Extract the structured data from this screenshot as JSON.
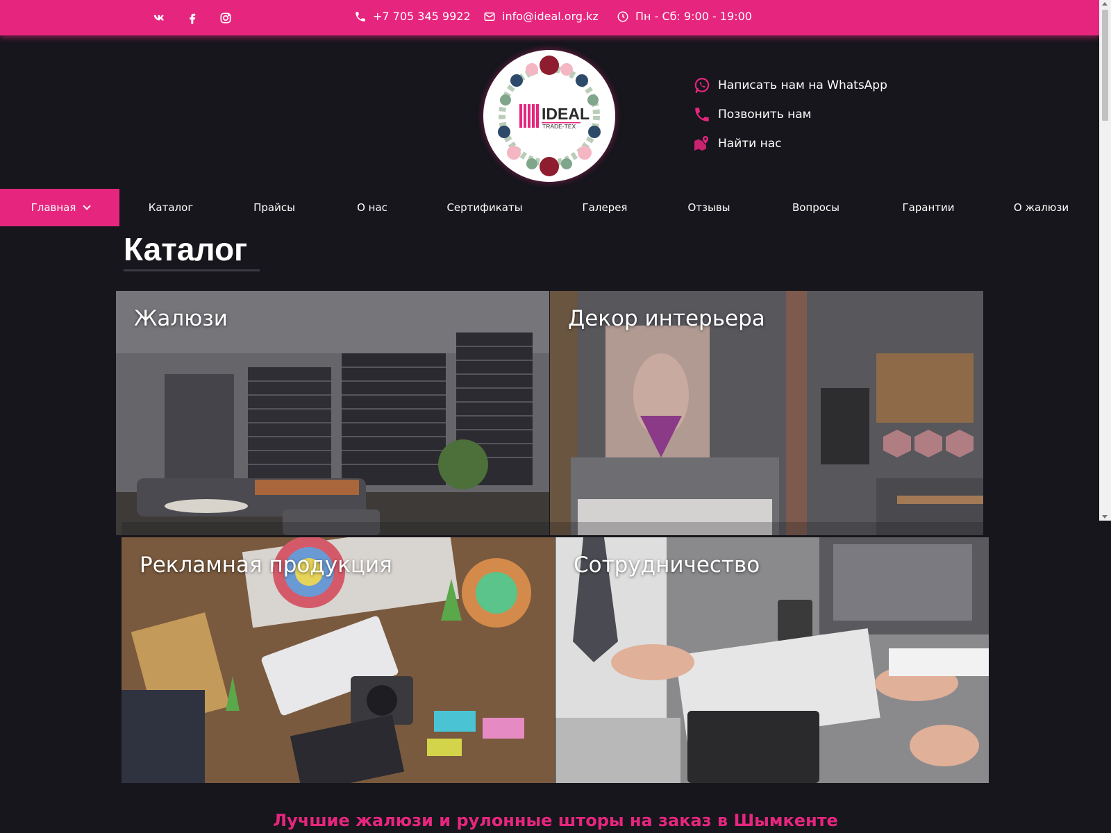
{
  "topbar": {
    "social": [
      {
        "name": "vk-icon"
      },
      {
        "name": "facebook-icon"
      },
      {
        "name": "instagram-icon"
      }
    ],
    "phone": "+7 705 345 9922",
    "email": "info@ideal.org.kz",
    "hours": "Пн - Сб: 9:00 - 19:00"
  },
  "logo": {
    "brand": "IDEAL",
    "sub": "TRADE-TEX"
  },
  "contacts": [
    {
      "label": "Написать нам на WhatsApp",
      "icon": "whatsapp-icon"
    },
    {
      "label": "Позвонить нам",
      "icon": "phone-icon"
    },
    {
      "label": "Найти нас",
      "icon": "map-pin-icon"
    }
  ],
  "nav": {
    "items": [
      {
        "label": "Главная",
        "active": true
      },
      {
        "label": "Каталог"
      },
      {
        "label": "Прайсы"
      },
      {
        "label": "О нас"
      },
      {
        "label": "Сертификаты"
      },
      {
        "label": "Галерея"
      },
      {
        "label": "Отзывы"
      },
      {
        "label": "Вопросы"
      },
      {
        "label": "Гарантии"
      },
      {
        "label": "О жалюзи"
      }
    ]
  },
  "catalog": {
    "title": "Каталог",
    "tiles": [
      {
        "label": "Жалюзи"
      },
      {
        "label": "Декор интерьера"
      },
      {
        "label": "Рекламная продукция"
      },
      {
        "label": "Сотрудничество"
      }
    ]
  },
  "footer_heading": "Лучшие жалюзи и рулонные шторы на заказ в Шымкенте",
  "colors": {
    "accent": "#e6267e",
    "background": "#16161c"
  }
}
